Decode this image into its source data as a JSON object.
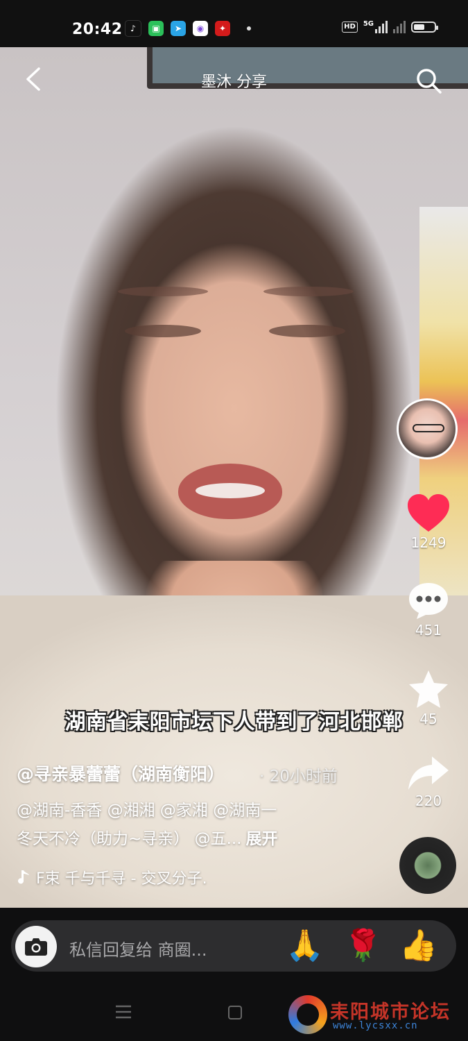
{
  "status_bar": {
    "time": "20:42",
    "apps": [
      "tiktok-icon",
      "wechat-icon",
      "telegram-icon",
      "message-icon",
      "news-icon"
    ],
    "network": "5G",
    "hd_label": "HD",
    "battery_level": 0.55
  },
  "header": {
    "title": "墨沐 分享"
  },
  "video": {
    "subtitle": "湖南省耒阳市坛下人带到了河北邯郸"
  },
  "rail": {
    "likes": "1249",
    "comments": "451",
    "favorites": "45",
    "shares": "220",
    "like_color": "#fe2c55"
  },
  "post": {
    "author": "@寻亲暴蕾蕾（湖南衡阳）",
    "time_ago": "· 20小时前",
    "desc_line1": "@湖南-香香 @湘湘 @家湘 @湖南一",
    "desc_line2": "冬天不冷（助力~寻亲） @五...",
    "expand": "展开",
    "music": "F束    千与千寻 - 交叉分子."
  },
  "input": {
    "placeholder": "私信回复给 商圈...",
    "emojis": [
      "🙏",
      "🌹",
      "👍"
    ]
  },
  "watermark": {
    "title": "耒阳城市论坛",
    "url": "www.lycsxx.cn"
  }
}
